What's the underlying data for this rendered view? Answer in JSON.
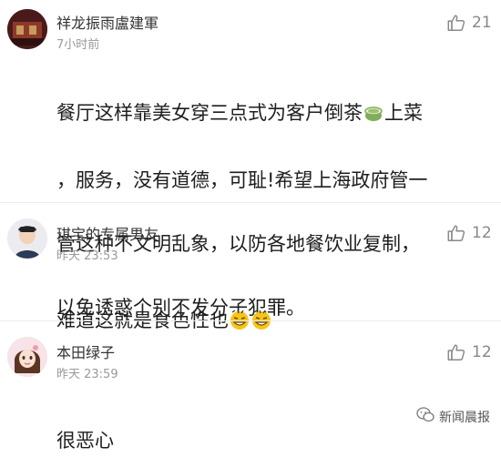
{
  "comments": [
    {
      "username": "祥龙振雨盧建軍",
      "time": "7小时前",
      "likes": "21",
      "lines": [
        "餐厅这样靠美女穿三点式为客户倒茶",
        "上菜",
        "，服务，没有道德，可耻!希望上海政府管一",
        "管这种不文明乱象，以防各地餐饮业复制，",
        "以免诱惑个别不发分子犯罪。"
      ]
    },
    {
      "username": "琪宝的专属男友",
      "time": "昨天 23:53",
      "likes": "12",
      "text": "难道这就是食色性也"
    },
    {
      "username": "本田绿子",
      "time": "昨天 23:59",
      "likes": "12",
      "text": "很恶心"
    }
  ],
  "watermark": "新闻晨报",
  "colors": {
    "text": "#1e1e1e",
    "meta": "#999999",
    "like": "#888888",
    "emoji": "#f5c518"
  }
}
